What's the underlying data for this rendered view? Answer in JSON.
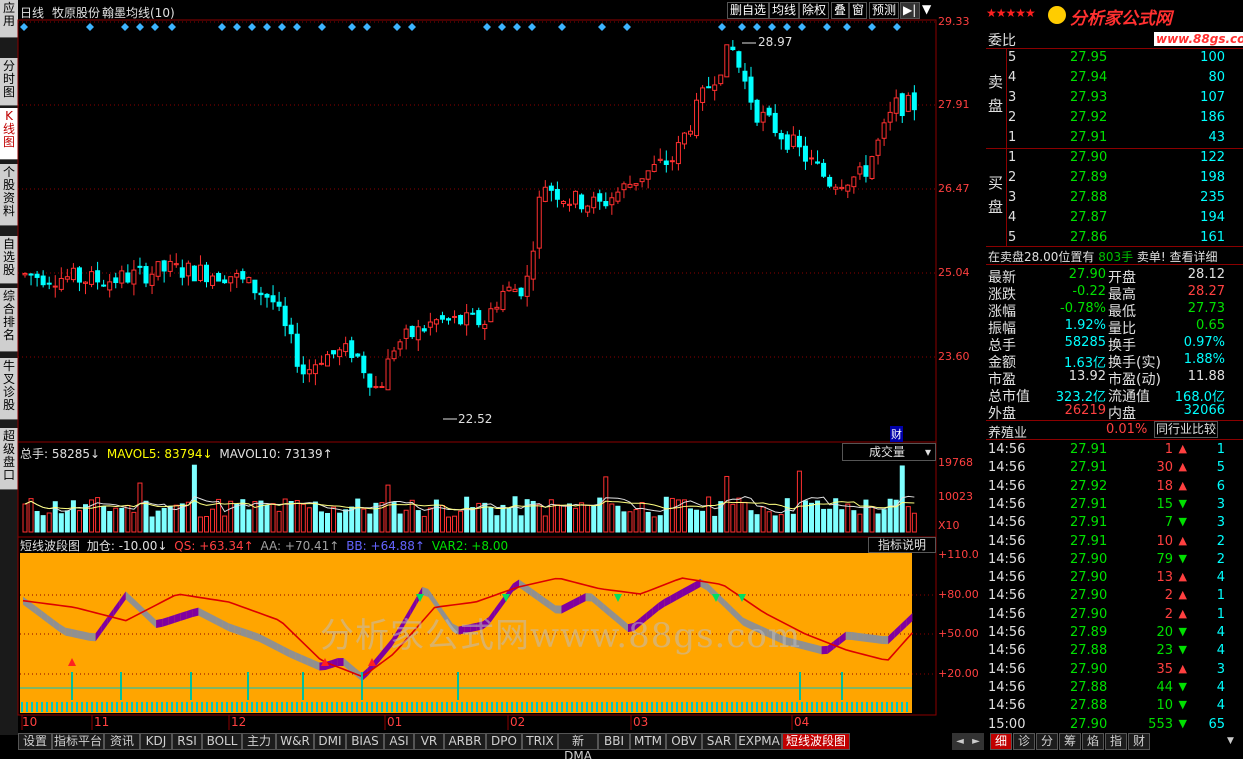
{
  "left_tabs": [
    "应用",
    "分时图",
    "K线图",
    "个股资料",
    "自选股",
    "综合排名",
    "牛叉诊股",
    "超级盘口"
  ],
  "header": {
    "period": "日线",
    "stock": "牧原股份",
    "indicator": "翰墨均线(10)",
    "buttons": [
      "删自选",
      "均线",
      "除权",
      "叠",
      "窗",
      "预测"
    ],
    "play_icon": "▶|",
    "dropdown_icon": "▼"
  },
  "price_axis": [
    "29.33",
    "27.91",
    "26.47",
    "25.04",
    "23.60"
  ],
  "price_high_label": "28.97",
  "price_low_label": "22.52",
  "cai_label": "财",
  "volume": {
    "label_total": "总手: 58285↓",
    "label_ma5": "MAVOL5: 83794↓",
    "label_ma10": "MAVOL10: 73139↑",
    "selector": "成交量",
    "axis": [
      "19768",
      "10023",
      "X10"
    ]
  },
  "indicator_panel": {
    "name": "短线波段图",
    "jiacang": "加仓: -10.00↓",
    "qs": "QS: +63.34↑",
    "aa": "AA: +70.41↑",
    "bb": "BB: +64.88↑",
    "var2": "VAR2: +8.00",
    "help": "指标说明",
    "axis": [
      "+110.0",
      "+80.00",
      "+50.00",
      "+20.00"
    ],
    "watermark": "分析家公式网www.88gs.com"
  },
  "x_axis": [
    "10",
    "11",
    "12",
    "01",
    "02",
    "03",
    "04"
  ],
  "bottom_tabs": [
    "设置",
    "指标平台",
    "资讯",
    "KDJ",
    "RSI",
    "BOLL",
    "主力",
    "W&R",
    "DMI",
    "BIAS",
    "ASI",
    "VR",
    "ARBR",
    "DPO",
    "TRIX",
    "新DMA",
    "BBI",
    "MTM",
    "OBV",
    "SAR",
    "EXPMA",
    "短线波段图"
  ],
  "bottom_nav": [
    "◄",
    "►"
  ],
  "right_tabs": [
    "细",
    "诊",
    "分",
    "筹",
    "焰",
    "指",
    "财"
  ],
  "logo": {
    "stars": "★★★★★",
    "brand": "分析家公式网",
    "url": "www.88gs.com"
  },
  "order_book": {
    "weibi": "委比",
    "sell_label": "卖盘",
    "buy_label": "买盘",
    "sells": [
      {
        "lvl": "5",
        "price": "27.95",
        "vol": "100"
      },
      {
        "lvl": "4",
        "price": "27.94",
        "vol": "80"
      },
      {
        "lvl": "3",
        "price": "27.93",
        "vol": "107"
      },
      {
        "lvl": "2",
        "price": "27.92",
        "vol": "186"
      },
      {
        "lvl": "1",
        "price": "27.91",
        "vol": "43"
      }
    ],
    "buys": [
      {
        "lvl": "1",
        "price": "27.90",
        "vol": "122"
      },
      {
        "lvl": "2",
        "price": "27.89",
        "vol": "198"
      },
      {
        "lvl": "3",
        "price": "27.88",
        "vol": "235"
      },
      {
        "lvl": "4",
        "price": "27.87",
        "vol": "194"
      },
      {
        "lvl": "5",
        "price": "27.86",
        "vol": "161"
      }
    ],
    "notice_a": "在卖盘28.00位置有",
    "notice_vol": "803手",
    "notice_b": "卖单! 查看详细"
  },
  "quote": [
    [
      "最新",
      "27.90",
      "开盘",
      "28.12"
    ],
    [
      "涨跌",
      "-0.22",
      "最高",
      "28.27"
    ],
    [
      "涨幅",
      "-0.78%",
      "最低",
      "27.73"
    ],
    [
      "振幅",
      "1.92%",
      "量比",
      "0.65"
    ],
    [
      "总手",
      "58285",
      "换手",
      "0.97%"
    ],
    [
      "金额",
      "1.63亿",
      "换手(实)",
      "1.88%"
    ],
    [
      "市盈",
      "13.92",
      "市盈(动)",
      "11.88"
    ],
    [
      "总市值",
      "323.2亿",
      "流通值",
      "168.0亿"
    ],
    [
      "外盘",
      "26219",
      "内盘",
      "32066"
    ]
  ],
  "industry": {
    "name": "养殖业",
    "pct": "0.01%",
    "compare": "同行业比较"
  },
  "ticks": [
    {
      "t": "14:56",
      "p": "27.91",
      "v": "1",
      "d": "up",
      "n": "1"
    },
    {
      "t": "14:56",
      "p": "27.91",
      "v": "30",
      "d": "up",
      "n": "5"
    },
    {
      "t": "14:56",
      "p": "27.92",
      "v": "18",
      "d": "up",
      "n": "6"
    },
    {
      "t": "14:56",
      "p": "27.91",
      "v": "15",
      "d": "down",
      "n": "3"
    },
    {
      "t": "14:56",
      "p": "27.91",
      "v": "7",
      "d": "down",
      "n": "3"
    },
    {
      "t": "14:56",
      "p": "27.91",
      "v": "10",
      "d": "up",
      "n": "2"
    },
    {
      "t": "14:56",
      "p": "27.90",
      "v": "79",
      "d": "down",
      "n": "2"
    },
    {
      "t": "14:56",
      "p": "27.90",
      "v": "13",
      "d": "up",
      "n": "4"
    },
    {
      "t": "14:56",
      "p": "27.90",
      "v": "2",
      "d": "up",
      "n": "1"
    },
    {
      "t": "14:56",
      "p": "27.90",
      "v": "2",
      "d": "up",
      "n": "1"
    },
    {
      "t": "14:56",
      "p": "27.89",
      "v": "20",
      "d": "down",
      "n": "4"
    },
    {
      "t": "14:56",
      "p": "27.88",
      "v": "23",
      "d": "down",
      "n": "4"
    },
    {
      "t": "14:56",
      "p": "27.90",
      "v": "35",
      "d": "up",
      "n": "3"
    },
    {
      "t": "14:56",
      "p": "27.88",
      "v": "44",
      "d": "down",
      "n": "4"
    },
    {
      "t": "14:56",
      "p": "27.88",
      "v": "10",
      "d": "down",
      "n": "4"
    },
    {
      "t": "15:00",
      "p": "27.90",
      "v": "553",
      "d": "down",
      "n": "65"
    }
  ]
}
